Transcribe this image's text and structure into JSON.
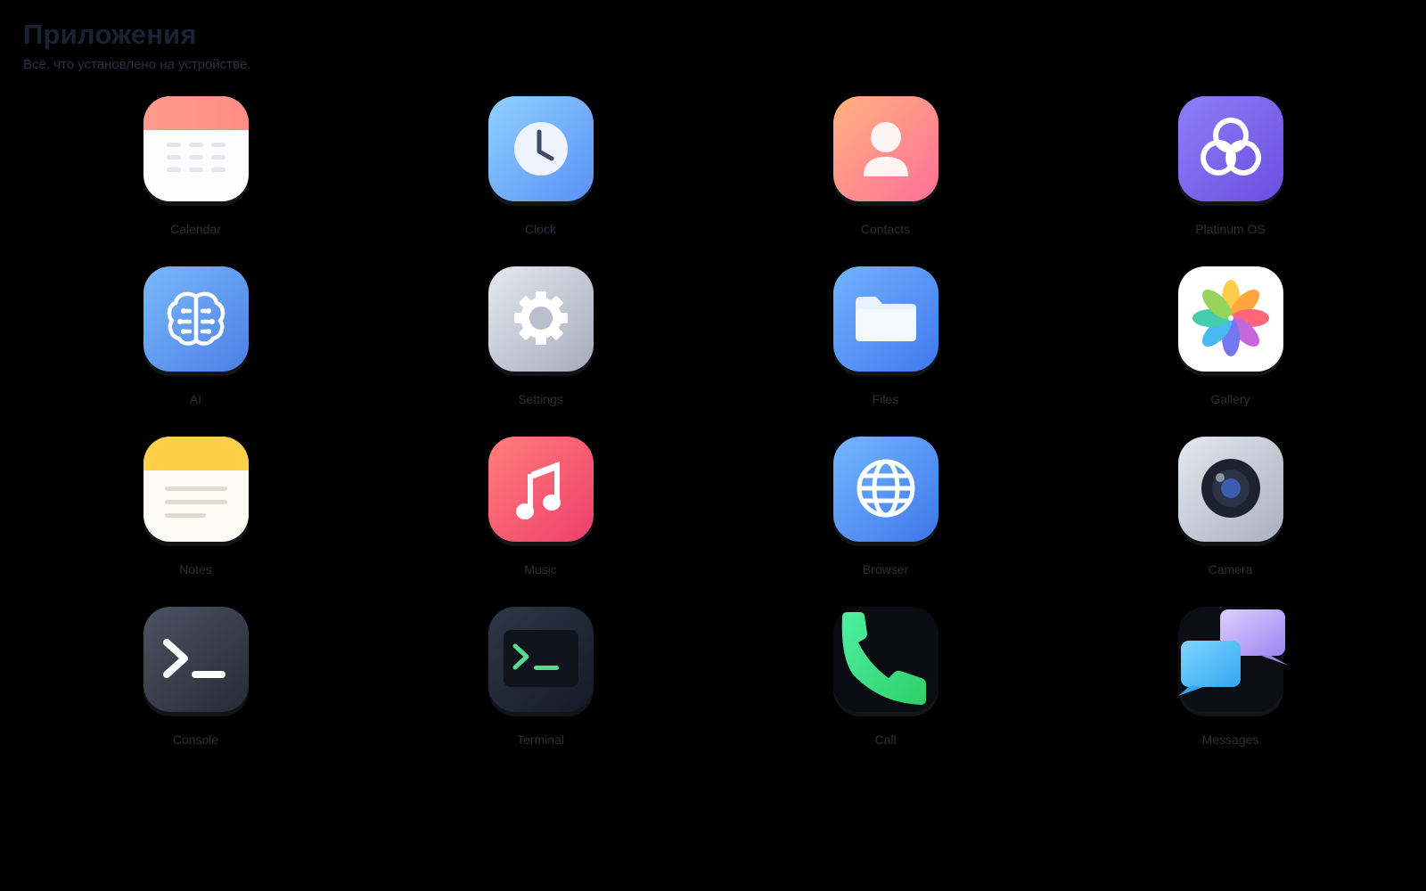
{
  "header": {
    "title": "Приложения",
    "subtitle": "Всё, что установлено на устройстве."
  },
  "apps": [
    {
      "label": "Calendar",
      "icon": "calendar-icon",
      "color": "#ff9a8b"
    },
    {
      "label": "Clock",
      "icon": "clock-icon",
      "color": "#6ea8fa"
    },
    {
      "label": "Contacts",
      "icon": "contacts-icon",
      "color": "#ff8a90"
    },
    {
      "label": "Platinum OS",
      "icon": "platinum-os-icon",
      "color": "#7a62ec"
    },
    {
      "label": "AI",
      "icon": "brain-icon",
      "color": "#5b93f0"
    },
    {
      "label": "Settings",
      "icon": "gear-icon",
      "color": "#c3c8d3"
    },
    {
      "label": "Files",
      "icon": "folder-icon",
      "color": "#4f8df5"
    },
    {
      "label": "Gallery",
      "icon": "gallery-flower-icon",
      "color": "#ffffff"
    },
    {
      "label": "Notes",
      "icon": "notes-icon",
      "color": "#ffd04d"
    },
    {
      "label": "Music",
      "icon": "music-note-icon",
      "color": "#f4566f"
    },
    {
      "label": "Browser",
      "icon": "globe-icon",
      "color": "#4d88f0"
    },
    {
      "label": "Camera",
      "icon": "camera-lens-icon",
      "color": "#c6cbd5"
    },
    {
      "label": "Console",
      "icon": "console-prompt-icon",
      "color": "#3a404d"
    },
    {
      "label": "Terminal",
      "icon": "terminal-prompt-icon",
      "color": "#1f2635"
    },
    {
      "label": "Call",
      "icon": "phone-icon",
      "color": "#3ddc84"
    },
    {
      "label": "Messages",
      "icon": "chat-bubbles-icon",
      "color": "#8fc8ff"
    }
  ]
}
